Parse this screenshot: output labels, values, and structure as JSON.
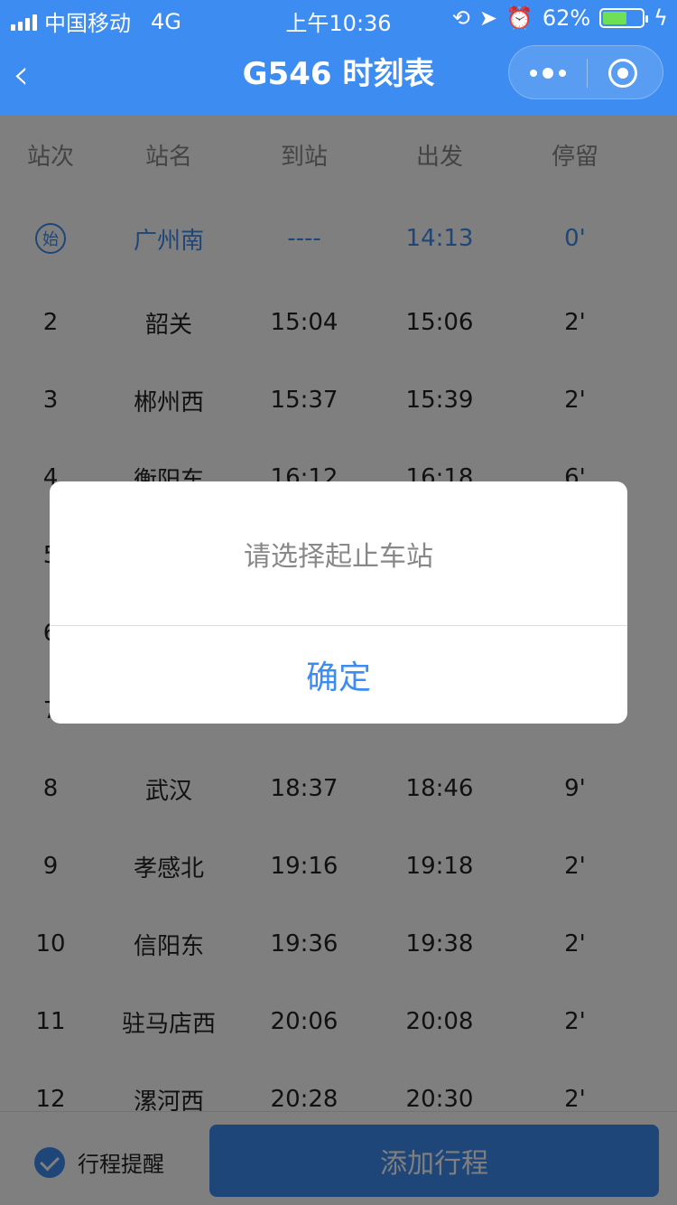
{
  "status_bar": {
    "carrier": "中国移动",
    "network": "4G",
    "time": "上午10:36",
    "battery": "62%",
    "icons": [
      "lock-rotation-icon",
      "location-icon",
      "alarm-icon",
      "battery-icon",
      "charging-icon"
    ]
  },
  "nav": {
    "back_icon": "‹",
    "title": "G546 时刻表"
  },
  "table": {
    "headers": [
      "站次",
      "站名",
      "到站",
      "出发",
      "停留"
    ],
    "first_row": {
      "badge": "始",
      "name": "广州南",
      "arrive": "----",
      "depart": "14:13",
      "stop": "0'"
    },
    "rows": [
      {
        "no": "2",
        "name": "韶关",
        "arrive": "15:04",
        "depart": "15:06",
        "stop": "2'"
      },
      {
        "no": "3",
        "name": "郴州西",
        "arrive": "15:37",
        "depart": "15:39",
        "stop": "2'"
      },
      {
        "no": "4",
        "name": "衡阳东",
        "arrive": "16:12",
        "depart": "16:18",
        "stop": "6'"
      },
      {
        "no": "5",
        "name": "",
        "arrive": "",
        "depart": "",
        "stop": ""
      },
      {
        "no": "6",
        "name": "",
        "arrive": "",
        "depart": "",
        "stop": ""
      },
      {
        "no": "7",
        "name": "",
        "arrive": "",
        "depart": "",
        "stop": ""
      },
      {
        "no": "8",
        "name": "武汉",
        "arrive": "18:37",
        "depart": "18:46",
        "stop": "9'"
      },
      {
        "no": "9",
        "name": "孝感北",
        "arrive": "19:16",
        "depart": "19:18",
        "stop": "2'"
      },
      {
        "no": "10",
        "name": "信阳东",
        "arrive": "19:36",
        "depart": "19:38",
        "stop": "2'"
      },
      {
        "no": "11",
        "name": "驻马店西",
        "arrive": "20:06",
        "depart": "20:08",
        "stop": "2'"
      },
      {
        "no": "12",
        "name": "漯河西",
        "arrive": "20:28",
        "depart": "20:30",
        "stop": "2'"
      }
    ]
  },
  "bottom": {
    "remind_label": "行程提醒",
    "add_label": "添加行程"
  },
  "dialog": {
    "message": "请选择起止车站",
    "confirm_label": "确定"
  },
  "colors": {
    "primary": "#3d8cf1",
    "mask": "rgba(0,0,0,0.5)"
  }
}
